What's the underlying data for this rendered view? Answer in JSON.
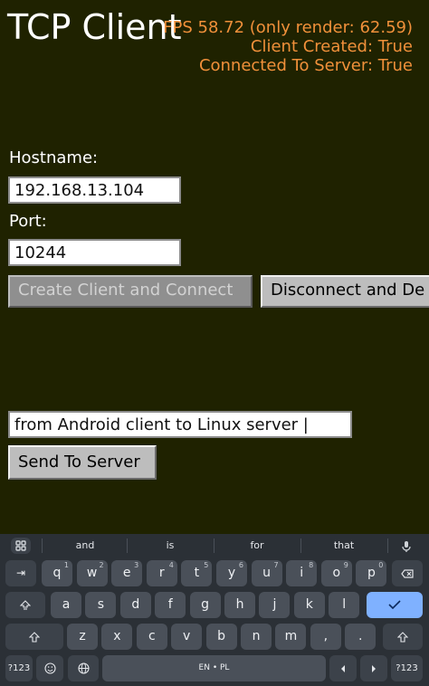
{
  "app": {
    "title": "TCP Client",
    "stats": {
      "fps": "FPS 58.72 (only render: 62.59)",
      "client_created": "Client Created: True",
      "connected": "Connected To Server: True"
    },
    "hostname_label": "Hostname:",
    "hostname_value": "192.168.13.104",
    "port_label": "Port:",
    "port_value": "10244",
    "create_button": "Create Client and Connect",
    "disconnect_button": "Disconnect and De",
    "message_value": "from Android client to Linux server |",
    "send_button": "Send To Server"
  },
  "keyboard": {
    "suggestions": [
      "and",
      "is",
      "for",
      "that"
    ],
    "row1": [
      {
        "k": "q",
        "n": "1"
      },
      {
        "k": "w",
        "n": "2"
      },
      {
        "k": "e",
        "n": "3"
      },
      {
        "k": "r",
        "n": "4"
      },
      {
        "k": "t",
        "n": "5"
      },
      {
        "k": "y",
        "n": "6"
      },
      {
        "k": "u",
        "n": "7"
      },
      {
        "k": "i",
        "n": "8"
      },
      {
        "k": "o",
        "n": "9"
      },
      {
        "k": "p",
        "n": "0"
      }
    ],
    "row2": [
      "a",
      "s",
      "d",
      "f",
      "g",
      "h",
      "j",
      "k",
      "l"
    ],
    "row3": [
      "z",
      "x",
      "c",
      "v",
      "b",
      "n",
      "m",
      ",",
      "."
    ],
    "symbols_label": "?123",
    "space_label": "EN • PL",
    "symbols_label_right": "?123"
  },
  "colors": {
    "background": "#1f2200",
    "stats_text": "#f0903a",
    "enter_key": "#7fb1ff"
  }
}
